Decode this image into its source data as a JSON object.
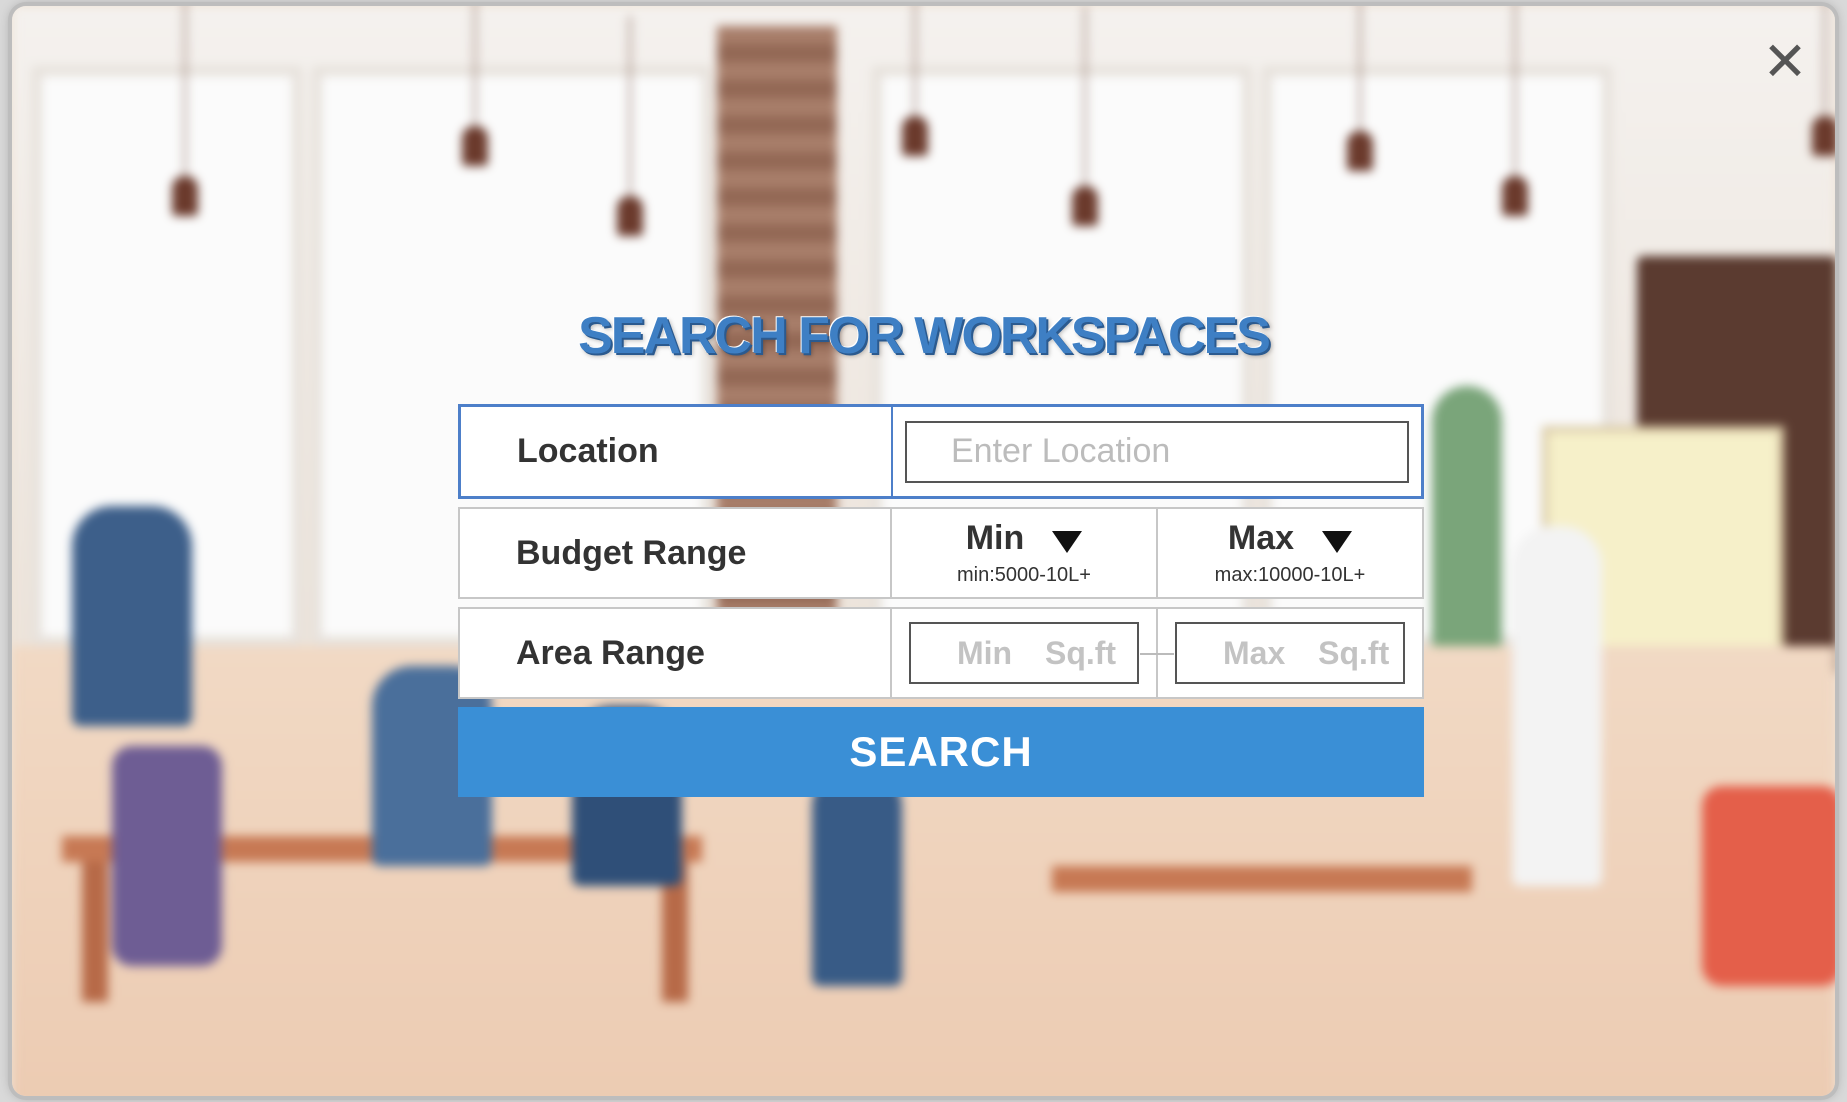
{
  "modal": {
    "close_glyph": "✕",
    "title": "SEARCH FOR WORKSPACES"
  },
  "form": {
    "location": {
      "label": "Location",
      "placeholder": "Enter Location",
      "value": ""
    },
    "budget": {
      "label": "Budget Range",
      "min": {
        "label": "Min",
        "hint": "min:5000-10L+"
      },
      "max": {
        "label": "Max",
        "hint": "max:10000-10L+"
      }
    },
    "area": {
      "label": "Area Range",
      "min_placeholder": "Min Sq.ft",
      "max_placeholder": "Max Sq.ft"
    },
    "search_label": "SEARCH"
  },
  "colors": {
    "accent": "#3a8fd6",
    "title": "#3e7fc4",
    "location_border": "#4d7fc9"
  }
}
